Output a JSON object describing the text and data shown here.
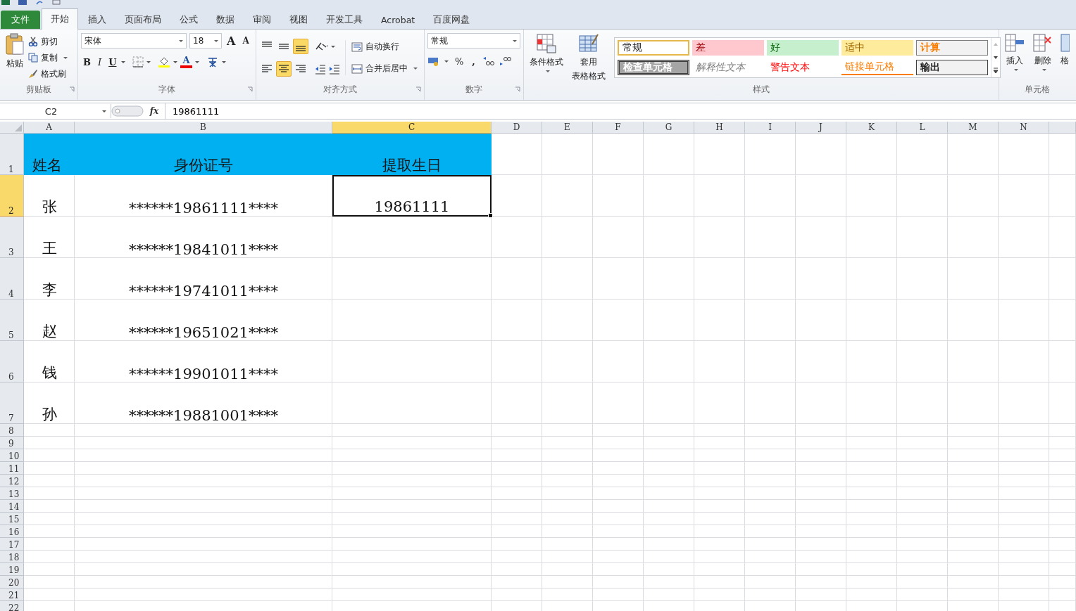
{
  "tabs": [
    {
      "label": "文件",
      "kind": "file",
      "selected": false
    },
    {
      "label": "开始",
      "kind": "tab",
      "selected": true
    },
    {
      "label": "插入",
      "kind": "tab",
      "selected": false
    },
    {
      "label": "页面布局",
      "kind": "tab",
      "selected": false
    },
    {
      "label": "公式",
      "kind": "tab",
      "selected": false
    },
    {
      "label": "数据",
      "kind": "tab",
      "selected": false
    },
    {
      "label": "审阅",
      "kind": "tab",
      "selected": false
    },
    {
      "label": "视图",
      "kind": "tab",
      "selected": false
    },
    {
      "label": "开发工具",
      "kind": "tab",
      "selected": false
    },
    {
      "label": "Acrobat",
      "kind": "tab",
      "selected": false
    },
    {
      "label": "百度网盘",
      "kind": "tab",
      "selected": false
    }
  ],
  "ribbon": {
    "clipboard": {
      "paste": "粘贴",
      "cut": "剪切",
      "copy": "复制",
      "format_painter": "格式刷",
      "label": "剪贴板"
    },
    "font": {
      "name": "宋体",
      "size": "18",
      "grow": "A",
      "shrink": "A",
      "bold": "B",
      "italic": "I",
      "underline": "U",
      "font_color": "A",
      "label": "字体"
    },
    "alignment": {
      "vertical": [
        {
          "kind": "top",
          "selected": false
        },
        {
          "kind": "middle",
          "selected": false
        },
        {
          "kind": "bottom",
          "selected": true
        }
      ],
      "horizontal": [
        {
          "kind": "left",
          "selected": false
        },
        {
          "kind": "center",
          "selected": true
        },
        {
          "kind": "right",
          "selected": false
        }
      ],
      "wrap": "自动换行",
      "merge": "合并后居中",
      "label": "对齐方式"
    },
    "number": {
      "format": "常规",
      "percent": "%",
      "comma": ",",
      "label": "数字"
    },
    "styles": {
      "conditional": "条件格式",
      "table_format": [
        "套用",
        "表格格式"
      ],
      "label": "样式",
      "gallery": [
        {
          "text": "常规",
          "kind": "normal"
        },
        {
          "text": "差",
          "kind": "bad"
        },
        {
          "text": "好",
          "kind": "good"
        },
        {
          "text": "适中",
          "kind": "neutral"
        },
        {
          "text": "计算",
          "kind": "calc"
        },
        {
          "text": "检查单元格",
          "kind": "check"
        },
        {
          "text": "解释性文本",
          "kind": "explanatory"
        },
        {
          "text": "警告文本",
          "kind": "warning"
        },
        {
          "text": "链接单元格",
          "kind": "linked"
        },
        {
          "text": "输出",
          "kind": "output"
        }
      ]
    },
    "cells": {
      "insert": "插入",
      "delete": "删除",
      "format": "格",
      "label": "单元格"
    }
  },
  "formula_bar": {
    "name_box": "C2",
    "fx": "fx",
    "value": "19861111"
  },
  "sheet": {
    "columns": [
      {
        "label": "A",
        "selected": false
      },
      {
        "label": "B",
        "selected": false
      },
      {
        "label": "C",
        "selected": true
      },
      {
        "label": "D",
        "selected": false
      },
      {
        "label": "E",
        "selected": false
      },
      {
        "label": "F",
        "selected": false
      },
      {
        "label": "G",
        "selected": false
      },
      {
        "label": "H",
        "selected": false
      },
      {
        "label": "I",
        "selected": false
      },
      {
        "label": "J",
        "selected": false
      },
      {
        "label": "K",
        "selected": false
      },
      {
        "label": "L",
        "selected": false
      },
      {
        "label": "M",
        "selected": false
      },
      {
        "label": "N",
        "selected": false
      }
    ],
    "rows": [
      {
        "number": "1",
        "kind": "header",
        "selected": false,
        "cells": [
          {
            "text": "姓名",
            "selected": false
          },
          {
            "text": "身份证号",
            "selected": false
          },
          {
            "text": "提取生日",
            "selected": false
          }
        ]
      },
      {
        "number": "2",
        "kind": "data",
        "selected": true,
        "cells": [
          {
            "text": "张",
            "selected": false
          },
          {
            "text": "******19861111****",
            "selected": false
          },
          {
            "text": "19861111",
            "selected": true
          }
        ]
      },
      {
        "number": "3",
        "kind": "data",
        "selected": false,
        "cells": [
          {
            "text": "王",
            "selected": false
          },
          {
            "text": "******19841011****",
            "selected": false
          }
        ]
      },
      {
        "number": "4",
        "kind": "data",
        "selected": false,
        "cells": [
          {
            "text": "李",
            "selected": false
          },
          {
            "text": "******19741011****",
            "selected": false
          }
        ]
      },
      {
        "number": "5",
        "kind": "data",
        "selected": false,
        "cells": [
          {
            "text": "赵",
            "selected": false
          },
          {
            "text": "******19651021****",
            "selected": false
          }
        ]
      },
      {
        "number": "6",
        "kind": "data",
        "selected": false,
        "cells": [
          {
            "text": "钱",
            "selected": false
          },
          {
            "text": "******19901011****",
            "selected": false
          }
        ]
      },
      {
        "number": "7",
        "kind": "data",
        "selected": false,
        "cells": [
          {
            "text": "孙",
            "selected": false
          },
          {
            "text": "******19881001****",
            "selected": false
          }
        ]
      },
      {
        "number": "8",
        "kind": "empty",
        "selected": false
      },
      {
        "number": "9",
        "kind": "empty",
        "selected": false
      },
      {
        "number": "10",
        "kind": "empty",
        "selected": false
      },
      {
        "number": "11",
        "kind": "empty",
        "selected": false
      },
      {
        "number": "12",
        "kind": "empty",
        "selected": false
      },
      {
        "number": "13",
        "kind": "empty",
        "selected": false
      },
      {
        "number": "14",
        "kind": "empty",
        "selected": false
      },
      {
        "number": "15",
        "kind": "empty",
        "selected": false
      },
      {
        "number": "16",
        "kind": "empty",
        "selected": false
      },
      {
        "number": "17",
        "kind": "empty",
        "selected": false
      },
      {
        "number": "18",
        "kind": "empty",
        "selected": false
      },
      {
        "number": "19",
        "kind": "empty",
        "selected": false
      },
      {
        "number": "20",
        "kind": "empty",
        "selected": false
      },
      {
        "number": "21",
        "kind": "empty",
        "selected": false
      },
      {
        "number": "22",
        "kind": "empty",
        "selected": false
      }
    ]
  }
}
